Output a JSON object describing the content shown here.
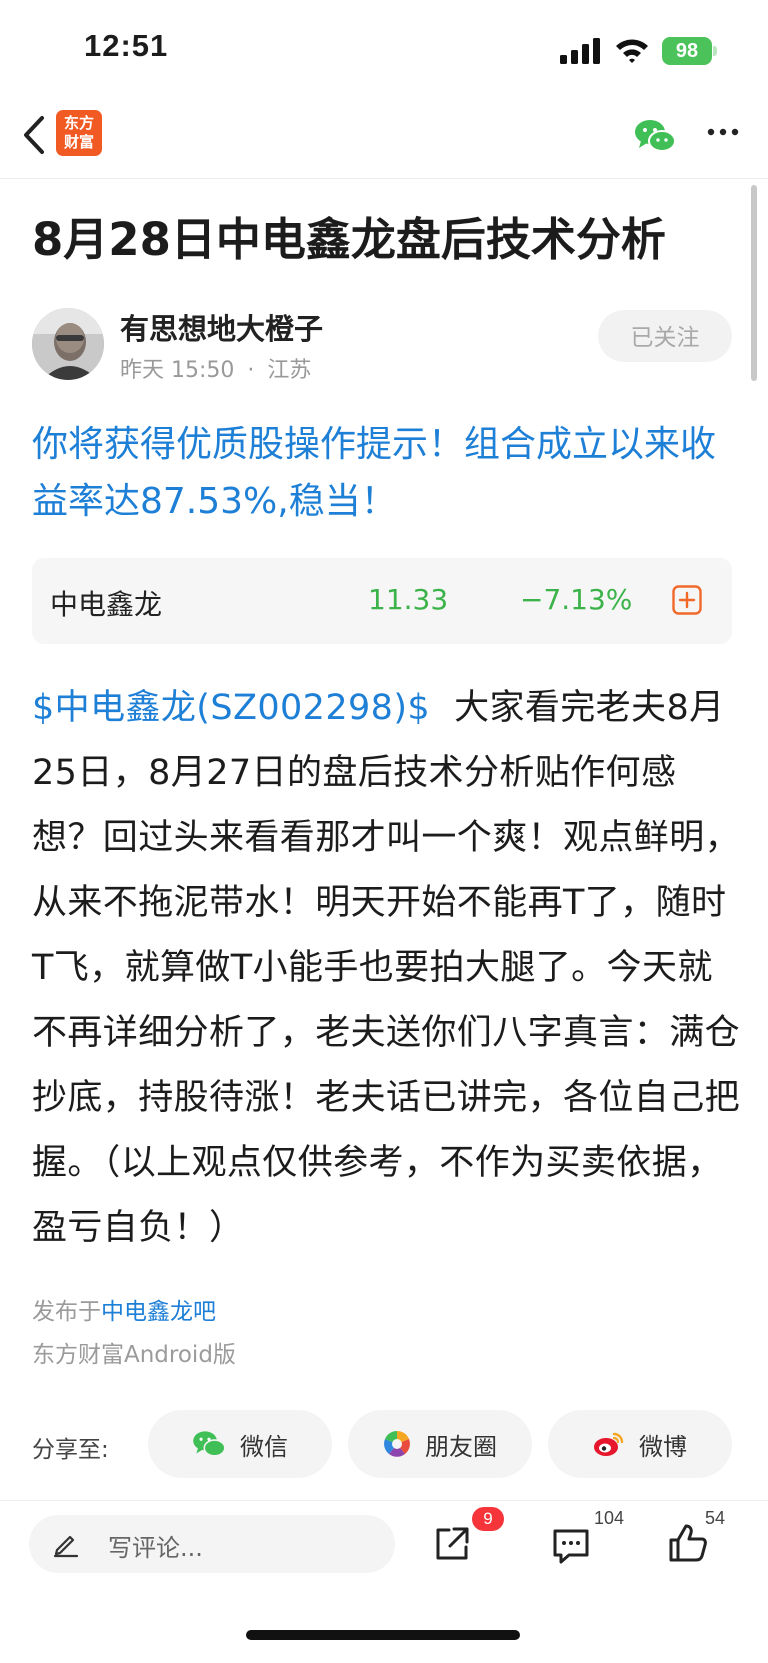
{
  "status_bar": {
    "time": "12:51",
    "battery": "98"
  },
  "nav": {
    "logo_line1": "东方",
    "logo_line2": "财富"
  },
  "article": {
    "title": "8月28日中电鑫龙盘后技术分析",
    "author": "有思想地大橙子",
    "time": "昨天 15:50",
    "separator": "·",
    "location": "江苏",
    "follow_label": "已关注",
    "promo_text": "你将获得优质股操作提示！组合成立以来收益率达87.53%,稳当！",
    "stock_tag": "$中电鑫龙(SZ002298)$",
    "body": "大家看完老夫8月25日，8月27日的盘后技术分析贴作何感想？回过头来看看那才叫一个爽！观点鲜明，从来不拖泥带水！明天开始不能再T了，随时T飞，就算做T小能手也要拍大腿了。今天就不再详细分析了，老夫送你们八字真言：满仓抄底，持股待涨！老夫话已讲完，各位自己把握。（以上观点仅供参考，不作为买卖依据，盈亏自负！）",
    "published_prefix": "发布于",
    "published_board": "中电鑫龙吧",
    "platform": "东方财富Android版"
  },
  "stock": {
    "name": "中电鑫龙",
    "price": "11.33",
    "change": "−7.13%"
  },
  "share": {
    "label": "分享至:",
    "wechat": "微信",
    "moments": "朋友圈",
    "weibo": "微博"
  },
  "bottom_bar": {
    "comment_placeholder": "写评论...",
    "share_badge": "9",
    "comment_count": "104",
    "like_count": "54"
  },
  "colors": {
    "brand": "#f25a23",
    "link": "#1d7fd6",
    "down": "#3cb34a",
    "badge": "#f5353a"
  }
}
